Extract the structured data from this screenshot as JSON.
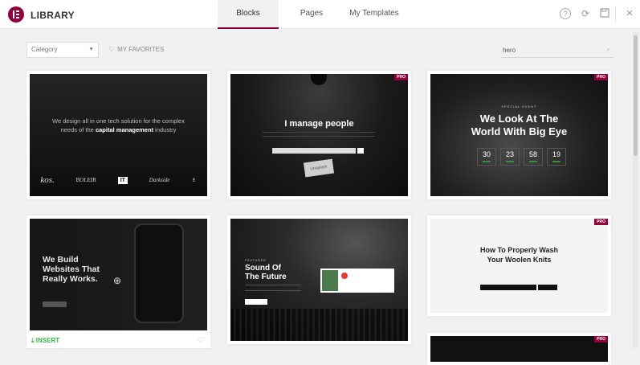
{
  "header": {
    "brand": "LIBRARY",
    "tabs": [
      {
        "label": "Blocks",
        "active": true
      },
      {
        "label": "Pages",
        "active": false
      },
      {
        "label": "My Templates",
        "active": false
      }
    ],
    "icons": [
      "help-icon",
      "sync-icon",
      "save-icon",
      "close-icon"
    ]
  },
  "toolbar": {
    "category": "Category",
    "favorites": "MY FAVORITES",
    "search_value": "hero"
  },
  "badge": "PRO",
  "templates": {
    "t1": {
      "line1": "We design all in one tech solution for the complex",
      "line2a": "needs of the ",
      "line2b": "capital management",
      "line2c": " industry",
      "logos": [
        "kos.",
        "BOLEIR",
        "IT",
        "Darkside",
        "♗"
      ]
    },
    "t2": {
      "title": "I manage people",
      "obj": "Unsplash"
    },
    "t3": {
      "kicker": "SPECIAL EVENT",
      "title1": "We Look At The",
      "title2": "World With Big Eye",
      "counts": [
        "30",
        "23",
        "58",
        "19"
      ]
    },
    "t4": {
      "line1": "We Build",
      "line2": "Websites That",
      "line3": "Really Works."
    },
    "t5": {
      "kicker": "FEATURED",
      "line1": "Sound Of",
      "line2": "The Future"
    },
    "t6": {
      "line1": "How To Properly Wash",
      "line2": "Your Woolen Knits"
    }
  },
  "card_actions": {
    "insert": "INSERT"
  },
  "colors": {
    "accent": "#92003b",
    "insert": "#39b54a"
  }
}
